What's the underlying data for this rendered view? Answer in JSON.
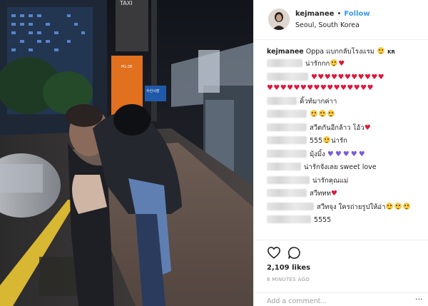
{
  "header": {
    "username": "kejmanee",
    "separator": "•",
    "follow_label": "Follow",
    "location": "Seoul, South Korea"
  },
  "photo": {
    "sign_taxi": "TAXI",
    "sign_station": "수산시장",
    "sign_pole_code": "PG-28"
  },
  "caption": {
    "username": "kejmanee",
    "text": "Oppa แบกกลับโรงแรม 😛🇰🇷",
    "text_plain": "Oppa แบกกลับโรงแรม",
    "flag": "KR"
  },
  "comments": [
    {
      "text": "น่ารักกก",
      "emoji": "face",
      "after": "♥"
    },
    {
      "text": "",
      "hearts": "♥♥♥♥♥♥♥♥♥♥♥"
    },
    {
      "text": "",
      "hearts": "♥♥♥♥♥♥♥♥♥♥♥♥♥♥♥♥"
    },
    {
      "text": "คิ้วท์มากค่าา"
    },
    {
      "text": "",
      "faces": 3
    },
    {
      "text": "สวีตกันอีกล้าว โอ้ว",
      "after": "♥"
    },
    {
      "text": "555",
      "emoji": "face",
      "after_text": "น่ารัก"
    },
    {
      "text": "มุ้งมิ้ง",
      "purple": "♥♥♥♥♥"
    },
    {
      "text": "น่ารักจังเลย sweet love"
    },
    {
      "text": "น่ารักคุณแม่"
    },
    {
      "text": "สวีททท",
      "after": "♥"
    },
    {
      "text": "สวีทจุง ใครถ่ายรูปให้อ่า",
      "faces": 3
    },
    {
      "text": "5555"
    }
  ],
  "actions": {
    "likes": "2,109 likes",
    "time": "8 MINUTES AGO",
    "comment_placeholder": "Add a comment...",
    "more": "···"
  },
  "colors": {
    "follow": "#3897f0",
    "heart": "#e0173a",
    "purple_heart": "#7b5cd6"
  }
}
